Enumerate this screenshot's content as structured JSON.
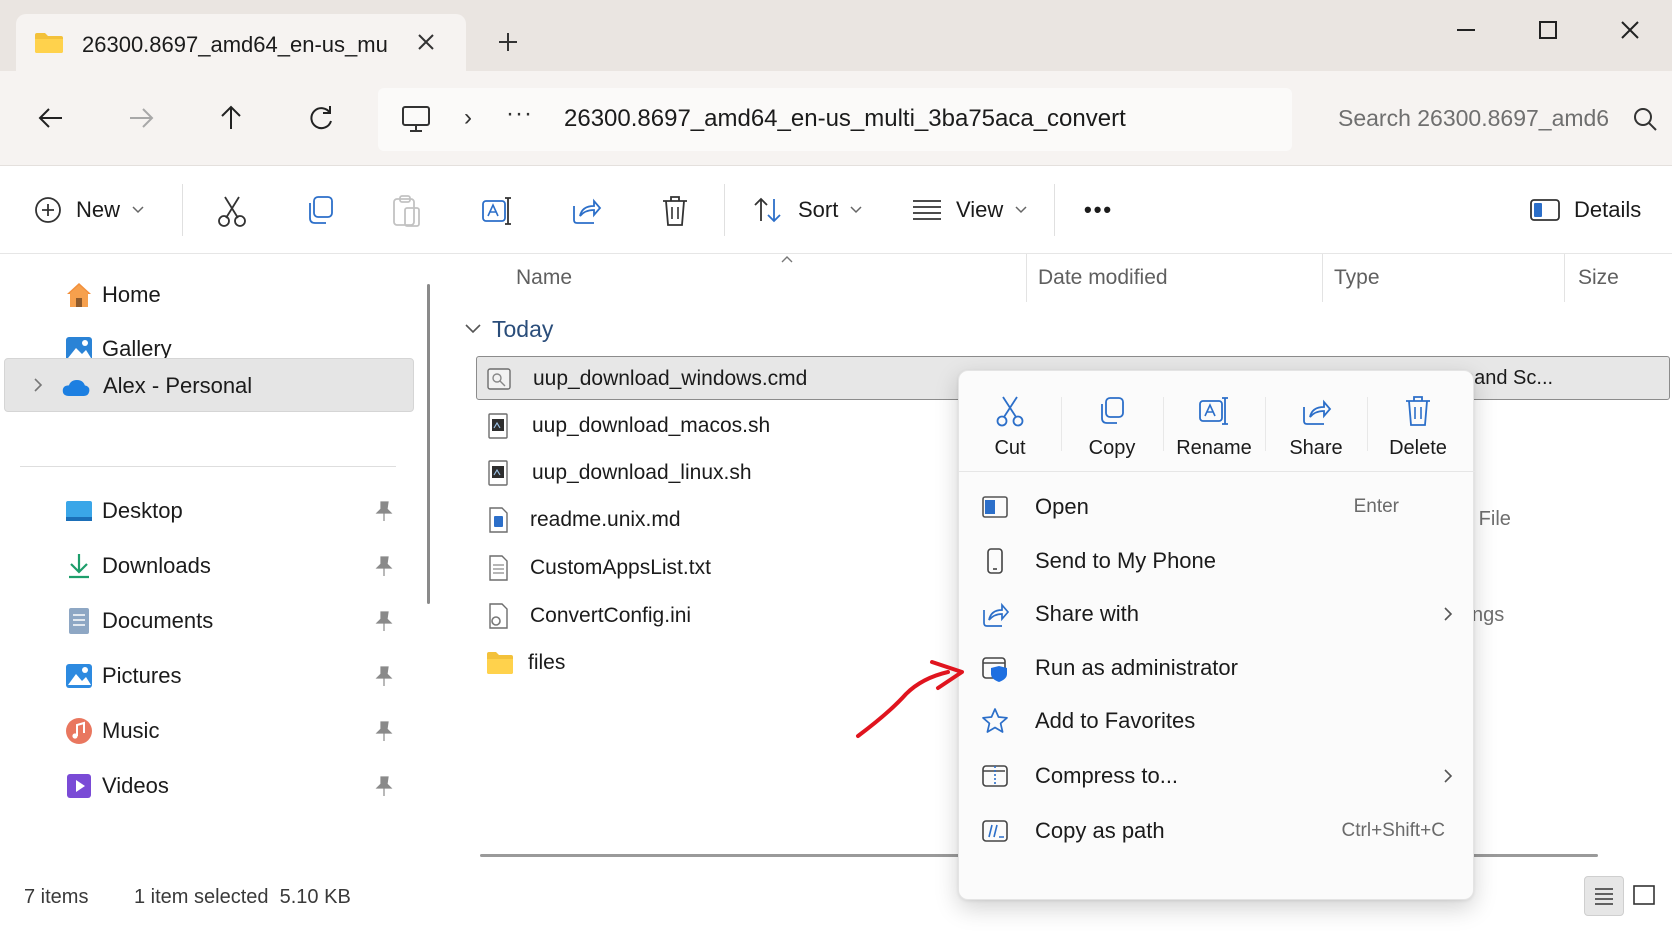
{
  "window": {
    "tab_title": "26300.8697_amd64_en-us_mu",
    "accent_color": "#005fb8"
  },
  "address_bar": {
    "path_overflow": "···",
    "current_folder": "26300.8697_amd64_en-us_multi_3ba75aca_convert",
    "search_placeholder": "Search 26300.8697_amd6"
  },
  "command_bar": {
    "new_label": "New",
    "sort_label": "Sort",
    "view_label": "View",
    "more_label": "•••",
    "details_label": "Details"
  },
  "sidebar": {
    "top_items": [
      {
        "label": "Home",
        "icon": "home-icon"
      },
      {
        "label": "Gallery",
        "icon": "gallery-icon"
      },
      {
        "label": "Alex - Personal",
        "icon": "onedrive-cloud-icon",
        "selected": true
      }
    ],
    "pinned_items": [
      {
        "label": "Desktop",
        "icon": "desktop-icon"
      },
      {
        "label": "Downloads",
        "icon": "downloads-icon"
      },
      {
        "label": "Documents",
        "icon": "documents-icon"
      },
      {
        "label": "Pictures",
        "icon": "pictures-icon"
      },
      {
        "label": "Music",
        "icon": "music-icon"
      },
      {
        "label": "Videos",
        "icon": "videos-icon"
      }
    ]
  },
  "file_list": {
    "columns": [
      "Name",
      "Date modified",
      "Type",
      "Size"
    ],
    "group": "Today",
    "files": [
      {
        "name": "uup_download_windows.cmd",
        "icon": "cmd-file-icon",
        "selected": true,
        "type_fragment": "nand Sc..."
      },
      {
        "name": "uup_download_macos.sh",
        "icon": "sh-file-icon"
      },
      {
        "name": "uup_download_linux.sh",
        "icon": "sh-file-icon"
      },
      {
        "name": "readme.unix.md",
        "icon": "md-file-icon",
        "type_fragment": "e File"
      },
      {
        "name": "CustomAppsList.txt",
        "icon": "text-file-icon"
      },
      {
        "name": "ConvertConfig.ini",
        "icon": "ini-file-icon",
        "type_fragment": "tings"
      },
      {
        "name": "files",
        "icon": "folder-icon"
      }
    ]
  },
  "status_bar": {
    "item_count": "7 items",
    "selection": "1 item selected  5.10 KB"
  },
  "context_menu": {
    "quick_actions": [
      {
        "label": "Cut",
        "icon": "cut-icon"
      },
      {
        "label": "Copy",
        "icon": "copy-icon"
      },
      {
        "label": "Rename",
        "icon": "rename-icon"
      },
      {
        "label": "Share",
        "icon": "share-icon"
      },
      {
        "label": "Delete",
        "icon": "delete-icon"
      }
    ],
    "items": [
      {
        "label": "Open",
        "shortcut": "Enter",
        "icon": "open-icon"
      },
      {
        "label": "Send to My Phone",
        "shortcut": "",
        "icon": "phone-icon"
      },
      {
        "label": "Share with",
        "shortcut": "",
        "icon": "share-with-icon",
        "submenu": true
      },
      {
        "label": "Run as administrator",
        "shortcut": "",
        "icon": "shield-admin-icon"
      },
      {
        "label": "Add to Favorites",
        "shortcut": "",
        "icon": "star-icon"
      },
      {
        "label": "Compress to...",
        "shortcut": "",
        "icon": "compress-icon",
        "submenu": true
      },
      {
        "label": "Copy as path",
        "shortcut": "Ctrl+Shift+C",
        "icon": "copy-path-icon"
      }
    ]
  },
  "annotation": {
    "arrow_color": "#e0141e",
    "points_to": "Run as administrator"
  }
}
